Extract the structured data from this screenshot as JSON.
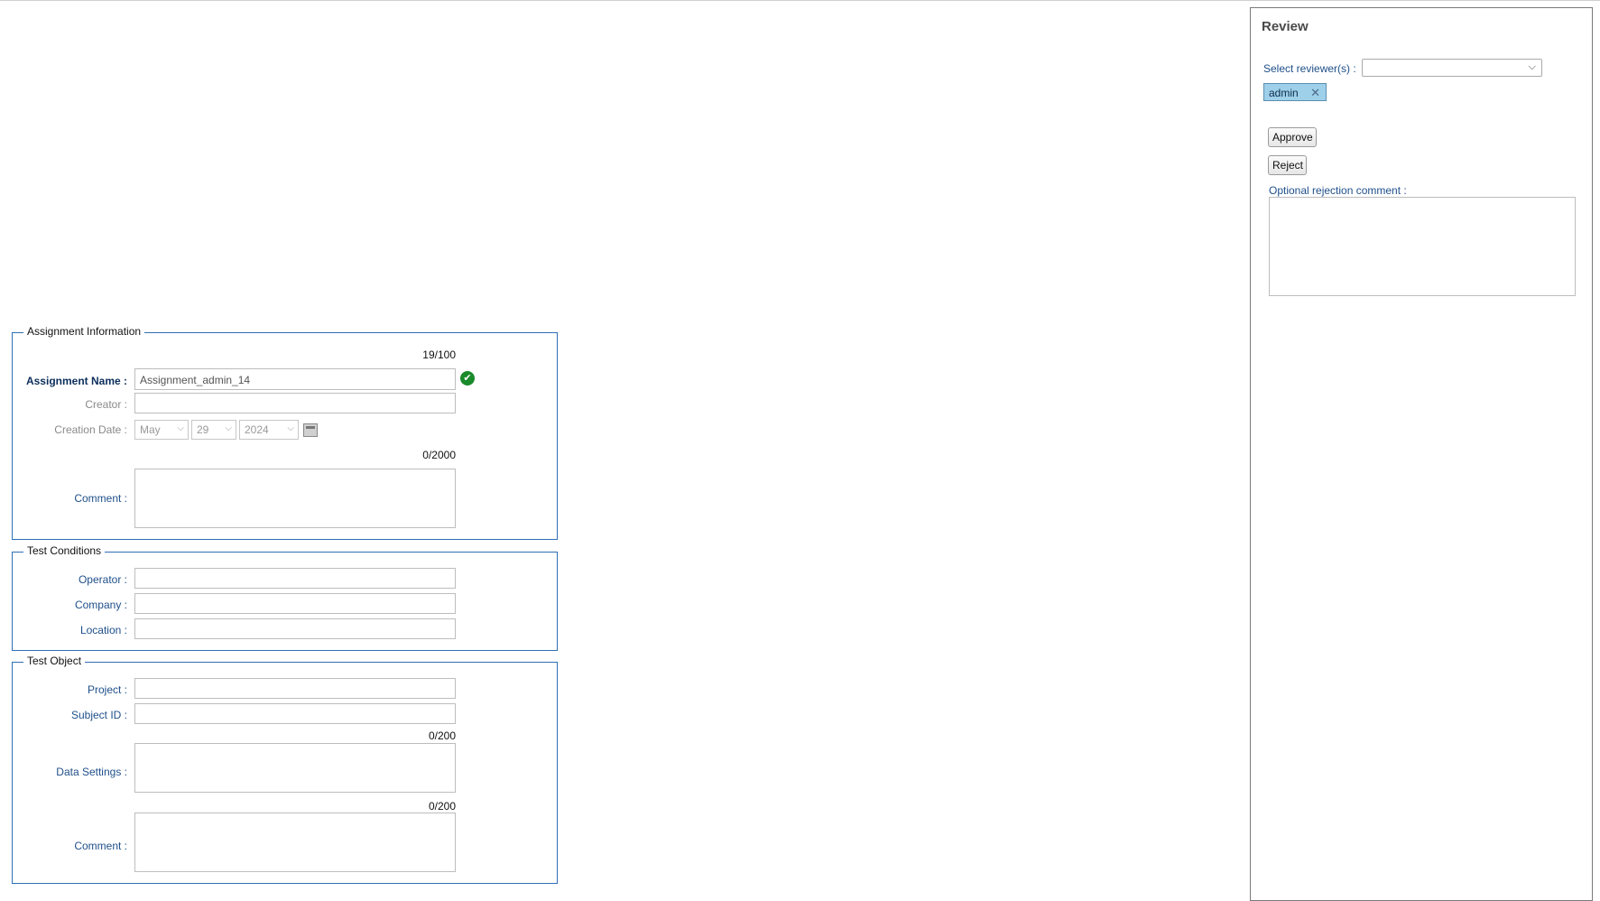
{
  "review": {
    "title": "Review",
    "select_label": "Select reviewer(s) :",
    "selected_tag": "admin",
    "approve_label": "Approve",
    "reject_label": "Reject",
    "rejection_comment_label": "Optional rejection comment :"
  },
  "assignment_info": {
    "legend": "Assignment Information",
    "name_counter": "19/100",
    "name_label": "Assignment Name :",
    "name_value": "Assignment_admin_14",
    "creator_label": "Creator :",
    "creator_value": "",
    "creation_date_label": "Creation Date :",
    "month": "May",
    "day": "29",
    "year": "2024",
    "comment_counter": "0/2000",
    "comment_label": "Comment :"
  },
  "test_conditions": {
    "legend": "Test Conditions",
    "operator_label": "Operator :",
    "company_label": "Company :",
    "location_label": "Location :"
  },
  "test_object": {
    "legend": "Test Object",
    "project_label": "Project :",
    "subject_id_label": "Subject ID :",
    "data_settings_counter": "0/200",
    "data_settings_label": "Data Settings :",
    "comment_counter": "0/200",
    "comment_label": "Comment :"
  },
  "colors": {
    "fieldset_border": "#2f6fb5",
    "label_blue": "#1f4f8a",
    "tag_bg": "#9fd0ea",
    "ok_green": "#1a8a2a"
  }
}
